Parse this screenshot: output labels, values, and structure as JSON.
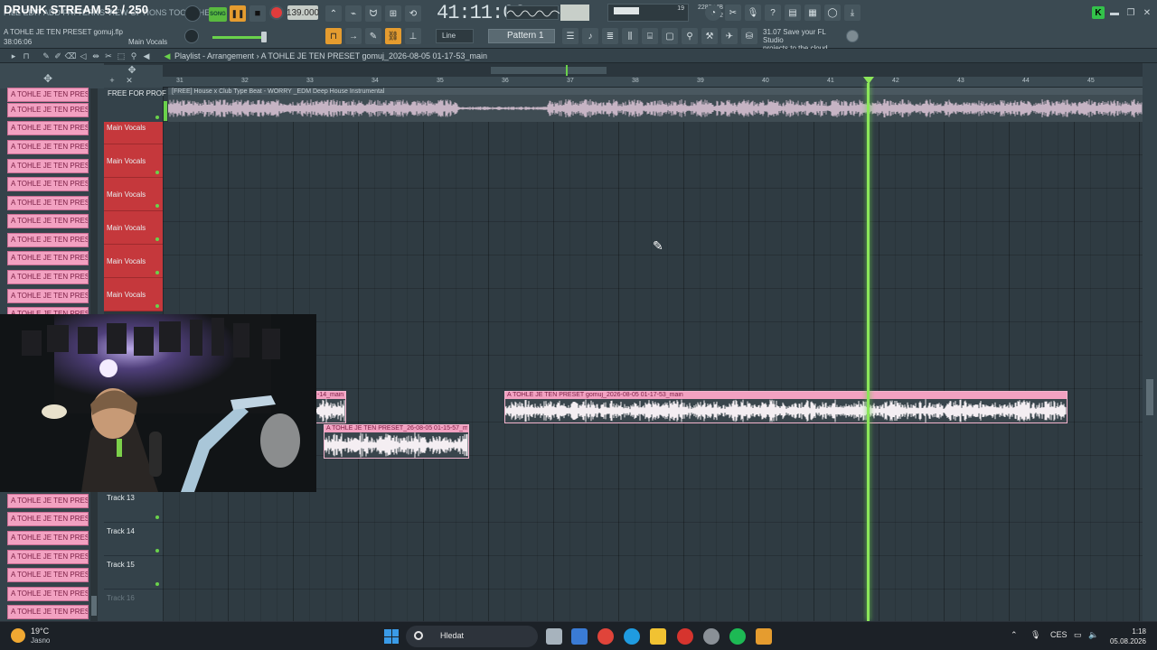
{
  "stream": {
    "title": "DRUNK STREAM 52 / 250",
    "menu_ghost": "FILE EDIT ADD PATTERNS VIEW OPTIONS TOOLS HELP"
  },
  "project": {
    "file": "A TOHLE JE TEN PRESET gomuj.flp",
    "time_small": "38:06:06",
    "hint": "Main Vocals"
  },
  "transport": {
    "song_label": "SONG",
    "tempo": "139.000",
    "time": "41:11:06",
    "snap": "Line",
    "pattern": "Pattern 1"
  },
  "monitor": {
    "cpu": "19",
    "memory": "2287 MB",
    "polyphony": "2"
  },
  "news": {
    "line1": "31.07  Save your FL Studio",
    "line2": "projects to the cloud"
  },
  "playlist": {
    "title": "Playlist - Arrangement",
    "arrangement": "A TOHLE JE TEN PRESET gomuj_2026-08-05 01-17-53_main"
  },
  "ruler": [
    "31",
    "32",
    "33",
    "34",
    "35",
    "36",
    "37",
    "38",
    "39",
    "40",
    "41",
    "42",
    "43",
    "44",
    "45"
  ],
  "picker": {
    "clip_label": "A TOHLE JE TEN PRESET g"
  },
  "tracks": {
    "ref": {
      "label": "FREE FOR PROF",
      "clip": "[FREE] House x Club Type Beat - WORRY _EDM Deep House Instrumental"
    },
    "main_vocals": "Main Vocals",
    "track13": "Track 13",
    "track14": "Track 14",
    "track15": "Track 15",
    "track16": "Track 16"
  },
  "clips": {
    "clip_a": "A TOHLE JE TEN PRESET gomuj_2026-08-05 01-17-53_main",
    "clip_b": "A TOHLE JE TEN PRESET_26-08-05 01-15-57_main",
    "clip_c": "-14_main"
  },
  "taskbar": {
    "temp": "19°C",
    "weather": "Jasno",
    "search": "Hledat",
    "lang": "CES",
    "time": "1:18",
    "date": "05.08.2026"
  },
  "colors": {
    "accent_green": "#6ad24b",
    "clip_pink": "#f2a1c1",
    "track_red": "#c5383c",
    "orange": "#e59c2f"
  }
}
